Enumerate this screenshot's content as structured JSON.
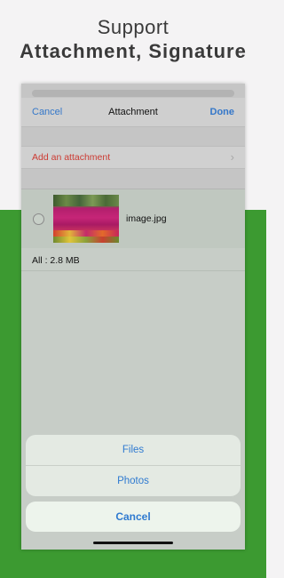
{
  "promo": {
    "line1": "Support",
    "line2": "Attachment, Signature"
  },
  "navbar": {
    "cancel_label": "Cancel",
    "title": "Attachment",
    "done_label": "Done"
  },
  "attachment_list": {
    "add_label": "Add an attachment",
    "chevron": "›",
    "files": [
      {
        "name": "image.jpg",
        "selected": false
      }
    ],
    "total_label": "All : 2.8 MB"
  },
  "action_sheet": {
    "items": [
      "Files",
      "Photos"
    ],
    "cancel_label": "Cancel"
  },
  "colors": {
    "accent_blue": "#2f7ad0",
    "destructive_red": "#cc3b33",
    "background_green": "#3c9a31"
  }
}
